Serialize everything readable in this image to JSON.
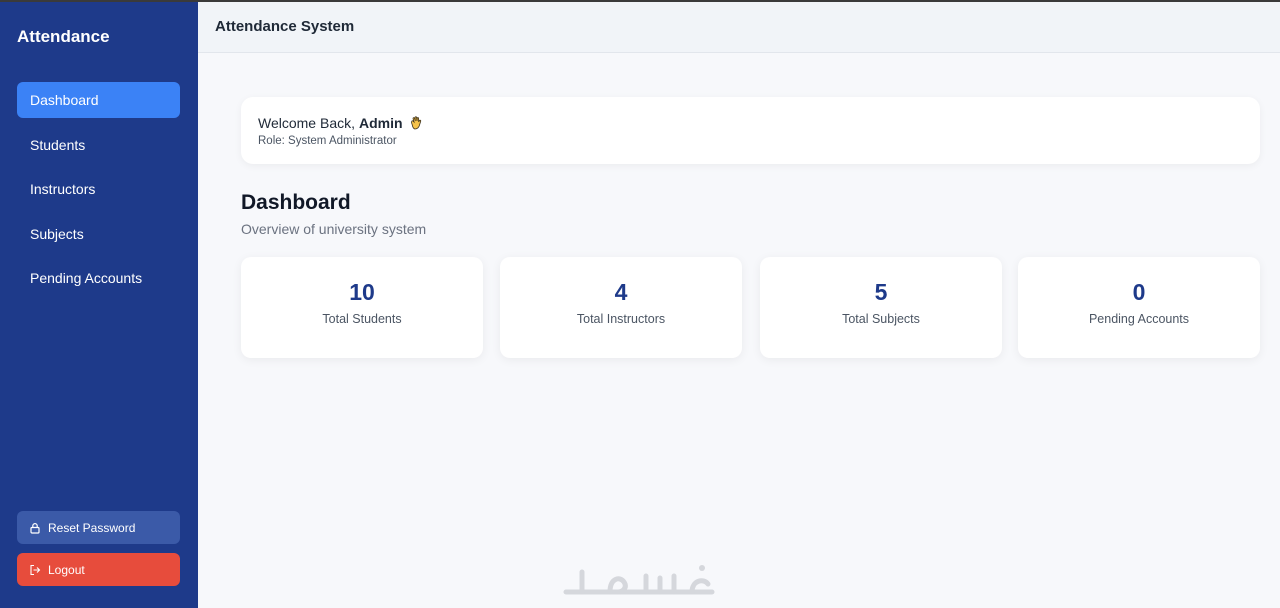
{
  "sidebar": {
    "brand": "Attendance",
    "items": [
      {
        "label": "Dashboard",
        "active": true
      },
      {
        "label": "Students",
        "active": false
      },
      {
        "label": "Instructors",
        "active": false
      },
      {
        "label": "Subjects",
        "active": false
      },
      {
        "label": "Pending Accounts",
        "active": false
      }
    ],
    "reset_label": "Reset Password",
    "reset_icon": "lock-icon",
    "logout_label": "Logout",
    "logout_icon": "logout-icon"
  },
  "header": {
    "title": "Attendance System"
  },
  "welcome": {
    "greeting": "Welcome Back,",
    "user": "Admin",
    "emoji_icon": "waving-hand-icon",
    "role": "Role: System Administrator"
  },
  "page": {
    "title": "Dashboard",
    "subtitle": "Overview of university system"
  },
  "stats": [
    {
      "value": "10",
      "label": "Total Students"
    },
    {
      "value": "4",
      "label": "Total Instructors"
    },
    {
      "value": "5",
      "label": "Total Subjects"
    },
    {
      "value": "0",
      "label": "Pending Accounts"
    }
  ],
  "colors": {
    "sidebar": "#1e3a8a",
    "active": "#3b82f6",
    "logout": "#e74c3c",
    "accent_text": "#1e3a8a"
  },
  "watermark_icon": "khamsat-watermark"
}
